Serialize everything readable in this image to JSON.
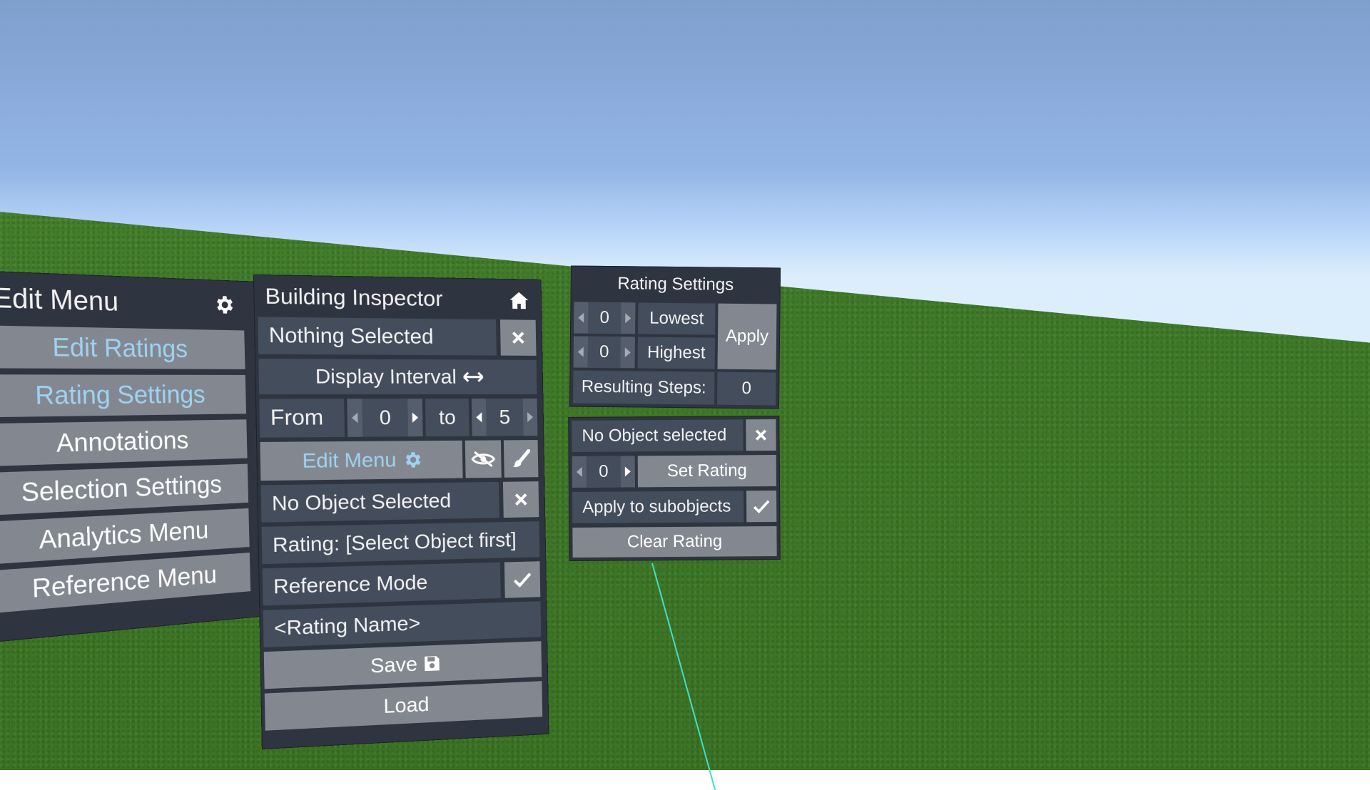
{
  "edit_menu": {
    "title": "Edit Menu",
    "icon": "gear-icon",
    "items": [
      {
        "label": "Edit Ratings",
        "highlighted": true
      },
      {
        "label": "Rating Settings",
        "highlighted": true
      },
      {
        "label": "Annotations",
        "highlighted": false
      },
      {
        "label": "Selection Settings",
        "highlighted": false
      },
      {
        "label": "Analytics Menu",
        "highlighted": false
      },
      {
        "label": "Reference Menu",
        "highlighted": false
      }
    ]
  },
  "building_inspector": {
    "title": "Building Inspector",
    "home_icon": "home-icon",
    "nothing_selected": "Nothing Selected",
    "close_icon": "close-icon",
    "display_interval": "Display Interval",
    "interval_icon": "arrows-horizontal-icon",
    "from_label": "From",
    "from_value": "0",
    "to_label": "to",
    "to_value": "5",
    "edit_menu_label": "Edit Menu",
    "edit_menu_icon": "gear-icon",
    "hide_icon": "eye-slash-icon",
    "paint_icon": "paintbrush-icon",
    "no_object_selected": "No Object Selected",
    "rating_text": "Rating: [Select Object first]",
    "reference_mode": "Reference Mode",
    "reference_mode_checked": true,
    "rating_name_placeholder": "<Rating Name>",
    "save_label": "Save",
    "save_icon": "floppy-disk-icon",
    "load_label": "Load"
  },
  "rating_settings": {
    "title": "Rating Settings",
    "lowest_value": "0",
    "lowest_label": "Lowest",
    "highest_value": "0",
    "highest_label": "Highest",
    "apply_label": "Apply",
    "resulting_steps_label": "Resulting Steps:",
    "resulting_steps_value": "0"
  },
  "object_rating": {
    "no_object_selected": "No Object selected",
    "rating_value": "0",
    "set_rating_label": "Set Rating",
    "apply_to_subobjects_label": "Apply to subobjects",
    "apply_to_subobjects_checked": true,
    "clear_rating_label": "Clear Rating"
  },
  "colors": {
    "panel": "#2f3540",
    "cell": "#444d5c",
    "button": "#838890",
    "highlight_text": "#9ed2f2",
    "laser": "#3fe0c8"
  }
}
